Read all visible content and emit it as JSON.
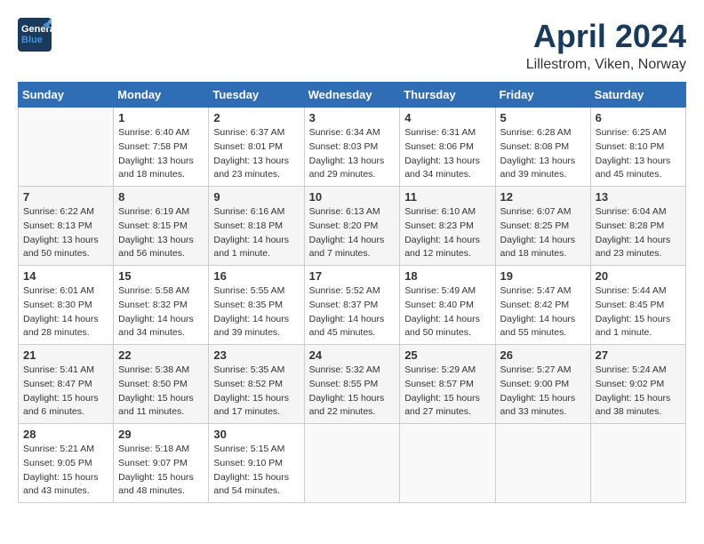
{
  "header": {
    "logo_line1": "General",
    "logo_line2": "Blue",
    "title": "April 2024",
    "subtitle": "Lillestrom, Viken, Norway"
  },
  "calendar": {
    "days_of_week": [
      "Sunday",
      "Monday",
      "Tuesday",
      "Wednesday",
      "Thursday",
      "Friday",
      "Saturday"
    ],
    "weeks": [
      [
        {
          "day": "",
          "info": ""
        },
        {
          "day": "1",
          "info": "Sunrise: 6:40 AM\nSunset: 7:58 PM\nDaylight: 13 hours\nand 18 minutes."
        },
        {
          "day": "2",
          "info": "Sunrise: 6:37 AM\nSunset: 8:01 PM\nDaylight: 13 hours\nand 23 minutes."
        },
        {
          "day": "3",
          "info": "Sunrise: 6:34 AM\nSunset: 8:03 PM\nDaylight: 13 hours\nand 29 minutes."
        },
        {
          "day": "4",
          "info": "Sunrise: 6:31 AM\nSunset: 8:06 PM\nDaylight: 13 hours\nand 34 minutes."
        },
        {
          "day": "5",
          "info": "Sunrise: 6:28 AM\nSunset: 8:08 PM\nDaylight: 13 hours\nand 39 minutes."
        },
        {
          "day": "6",
          "info": "Sunrise: 6:25 AM\nSunset: 8:10 PM\nDaylight: 13 hours\nand 45 minutes."
        }
      ],
      [
        {
          "day": "7",
          "info": "Sunrise: 6:22 AM\nSunset: 8:13 PM\nDaylight: 13 hours\nand 50 minutes."
        },
        {
          "day": "8",
          "info": "Sunrise: 6:19 AM\nSunset: 8:15 PM\nDaylight: 13 hours\nand 56 minutes."
        },
        {
          "day": "9",
          "info": "Sunrise: 6:16 AM\nSunset: 8:18 PM\nDaylight: 14 hours\nand 1 minute."
        },
        {
          "day": "10",
          "info": "Sunrise: 6:13 AM\nSunset: 8:20 PM\nDaylight: 14 hours\nand 7 minutes."
        },
        {
          "day": "11",
          "info": "Sunrise: 6:10 AM\nSunset: 8:23 PM\nDaylight: 14 hours\nand 12 minutes."
        },
        {
          "day": "12",
          "info": "Sunrise: 6:07 AM\nSunset: 8:25 PM\nDaylight: 14 hours\nand 18 minutes."
        },
        {
          "day": "13",
          "info": "Sunrise: 6:04 AM\nSunset: 8:28 PM\nDaylight: 14 hours\nand 23 minutes."
        }
      ],
      [
        {
          "day": "14",
          "info": "Sunrise: 6:01 AM\nSunset: 8:30 PM\nDaylight: 14 hours\nand 28 minutes."
        },
        {
          "day": "15",
          "info": "Sunrise: 5:58 AM\nSunset: 8:32 PM\nDaylight: 14 hours\nand 34 minutes."
        },
        {
          "day": "16",
          "info": "Sunrise: 5:55 AM\nSunset: 8:35 PM\nDaylight: 14 hours\nand 39 minutes."
        },
        {
          "day": "17",
          "info": "Sunrise: 5:52 AM\nSunset: 8:37 PM\nDaylight: 14 hours\nand 45 minutes."
        },
        {
          "day": "18",
          "info": "Sunrise: 5:49 AM\nSunset: 8:40 PM\nDaylight: 14 hours\nand 50 minutes."
        },
        {
          "day": "19",
          "info": "Sunrise: 5:47 AM\nSunset: 8:42 PM\nDaylight: 14 hours\nand 55 minutes."
        },
        {
          "day": "20",
          "info": "Sunrise: 5:44 AM\nSunset: 8:45 PM\nDaylight: 15 hours\nand 1 minute."
        }
      ],
      [
        {
          "day": "21",
          "info": "Sunrise: 5:41 AM\nSunset: 8:47 PM\nDaylight: 15 hours\nand 6 minutes."
        },
        {
          "day": "22",
          "info": "Sunrise: 5:38 AM\nSunset: 8:50 PM\nDaylight: 15 hours\nand 11 minutes."
        },
        {
          "day": "23",
          "info": "Sunrise: 5:35 AM\nSunset: 8:52 PM\nDaylight: 15 hours\nand 17 minutes."
        },
        {
          "day": "24",
          "info": "Sunrise: 5:32 AM\nSunset: 8:55 PM\nDaylight: 15 hours\nand 22 minutes."
        },
        {
          "day": "25",
          "info": "Sunrise: 5:29 AM\nSunset: 8:57 PM\nDaylight: 15 hours\nand 27 minutes."
        },
        {
          "day": "26",
          "info": "Sunrise: 5:27 AM\nSunset: 9:00 PM\nDaylight: 15 hours\nand 33 minutes."
        },
        {
          "day": "27",
          "info": "Sunrise: 5:24 AM\nSunset: 9:02 PM\nDaylight: 15 hours\nand 38 minutes."
        }
      ],
      [
        {
          "day": "28",
          "info": "Sunrise: 5:21 AM\nSunset: 9:05 PM\nDaylight: 15 hours\nand 43 minutes."
        },
        {
          "day": "29",
          "info": "Sunrise: 5:18 AM\nSunset: 9:07 PM\nDaylight: 15 hours\nand 48 minutes."
        },
        {
          "day": "30",
          "info": "Sunrise: 5:15 AM\nSunset: 9:10 PM\nDaylight: 15 hours\nand 54 minutes."
        },
        {
          "day": "",
          "info": ""
        },
        {
          "day": "",
          "info": ""
        },
        {
          "day": "",
          "info": ""
        },
        {
          "day": "",
          "info": ""
        }
      ]
    ]
  }
}
